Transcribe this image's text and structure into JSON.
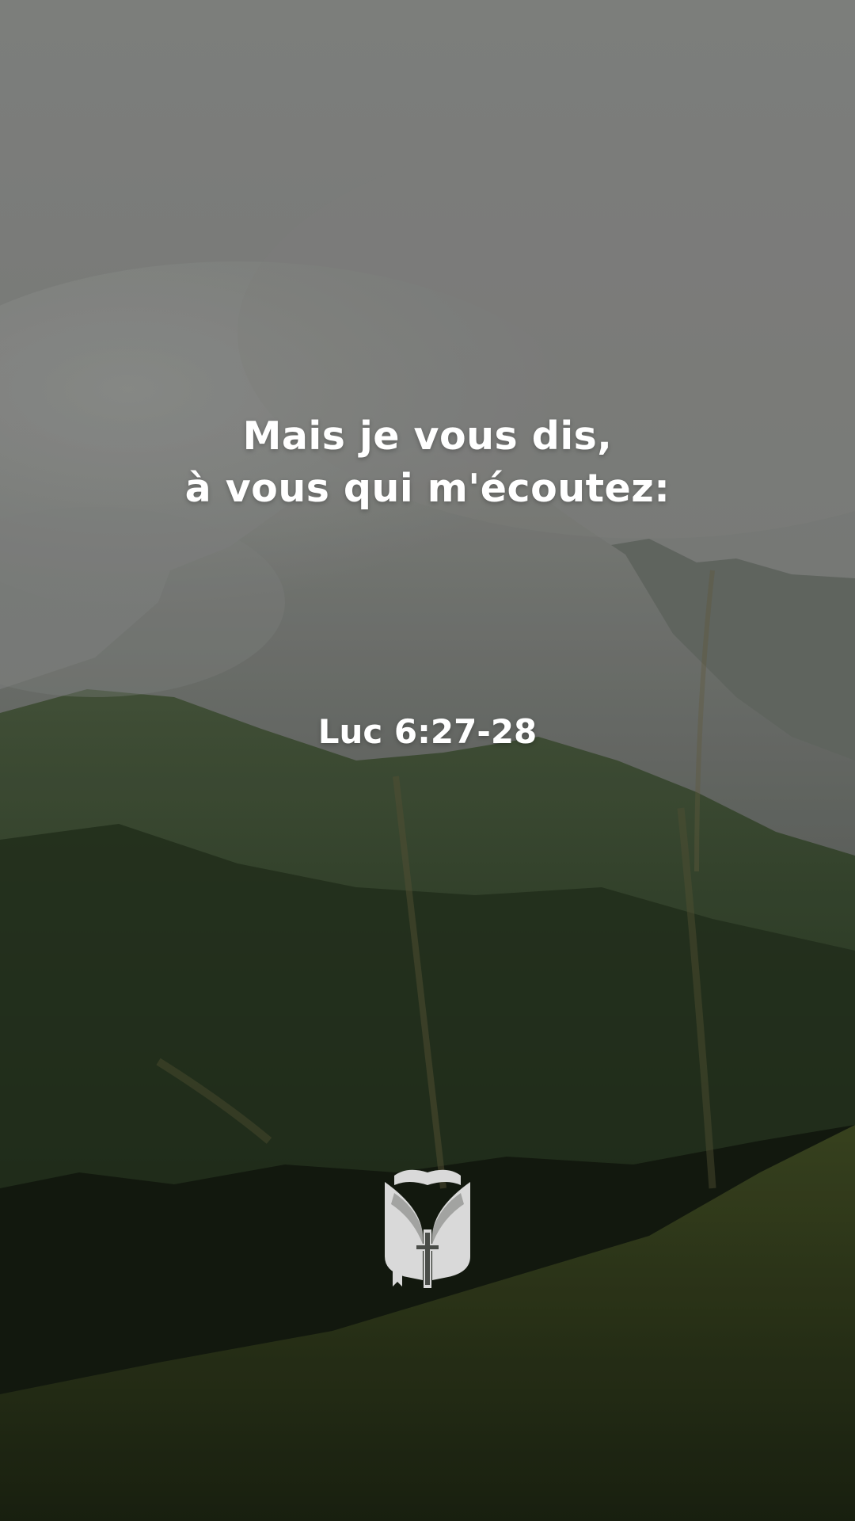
{
  "verse": {
    "line1": "Mais je vous dis,",
    "line2": "à vous qui m'écoutez:"
  },
  "reference": "Luc 6:27-28",
  "logo": {
    "icon": "bible-book-cross-icon",
    "color": "#d9d9d9"
  },
  "background": {
    "description_icon": "mountain-landscape-photo"
  }
}
